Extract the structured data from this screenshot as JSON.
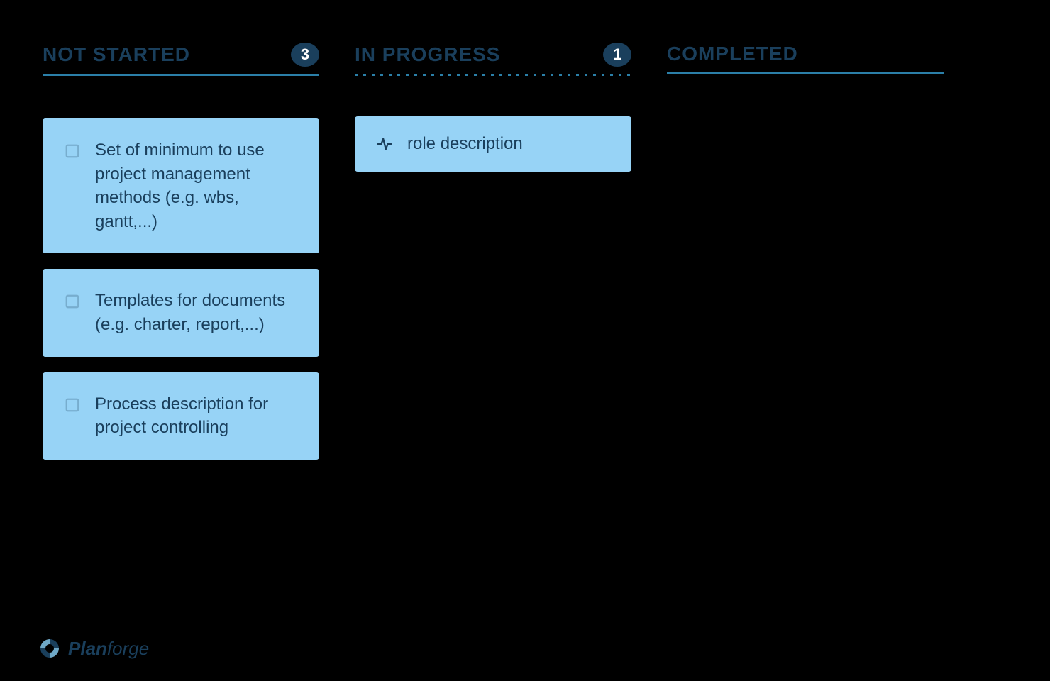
{
  "columns": {
    "not_started": {
      "title": "NOT STARTED",
      "count": "3",
      "cards": [
        {
          "text": "Set of minimum to use project management methods (e.g. wbs, gantt,...)"
        },
        {
          "text": "Templates for documents (e.g. charter, report,...)"
        },
        {
          "text": "Process description for project controlling"
        }
      ]
    },
    "in_progress": {
      "title": "IN PROGRESS",
      "count": "1",
      "cards": [
        {
          "text": "role description"
        }
      ]
    },
    "completed": {
      "title": "COMPLETED"
    }
  },
  "logo": {
    "brand_bold": "Plan",
    "brand_light": "forge"
  }
}
